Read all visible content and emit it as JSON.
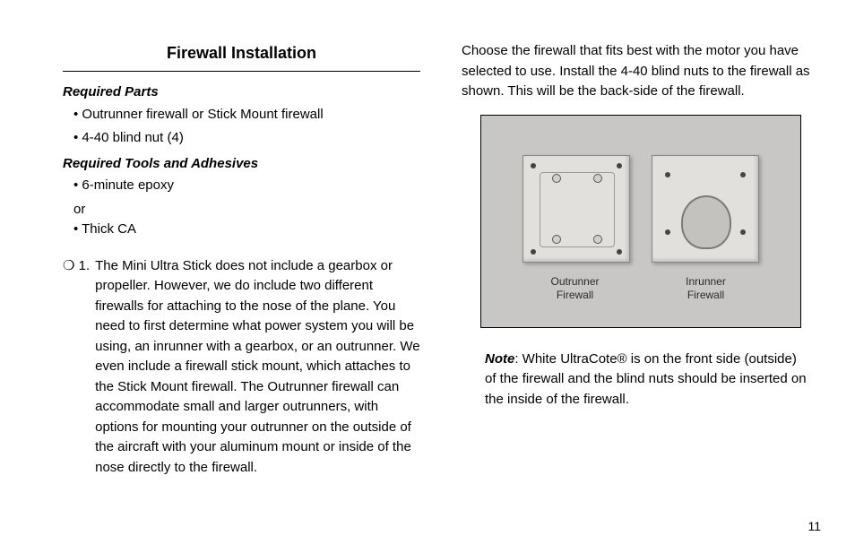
{
  "heading": "Firewall Installation",
  "required_parts_label": "Required Parts",
  "required_parts": {
    "b1": "• Outrunner firewall or Stick Mount firewall",
    "b2": "• 4-40 blind nut (4)"
  },
  "required_tools_label": "Required Tools and Adhesives",
  "required_tools": {
    "b1": "• 6-minute epoxy",
    "or": "or",
    "b2": "• Thick CA"
  },
  "step1_marker": "❍ 1.",
  "step1_body": "The Mini Ultra Stick does not include a gearbox or propeller. However, we do include two different firewalls for attaching to the nose of the plane. You need to first determine what power system you will be using, an inrunner with a gearbox, or an outrunner. We even include a firewall stick mount, which attaches to the Stick Mount firewall. The Outrunner firewall can accommodate small and larger outrunners, with options for mounting your outrunner on the outside of the aircraft with your aluminum mount or inside of the nose directly to the firewall.",
  "right_intro": "Choose the firewall that fits best with the motor you have selected to use. Install the 4-40 blind nuts to the firewall as shown. This will be the back-side of the firewall.",
  "caption_left_1": "Outrunner",
  "caption_left_2": "Firewall",
  "caption_right_1": "Inrunner",
  "caption_right_2": "Firewall",
  "note_lead": "Note",
  "note_body": ": White UltraCote® is on the front side (outside) of the firewall and the blind nuts should be inserted on the inside of the firewall.",
  "page_number": "11"
}
